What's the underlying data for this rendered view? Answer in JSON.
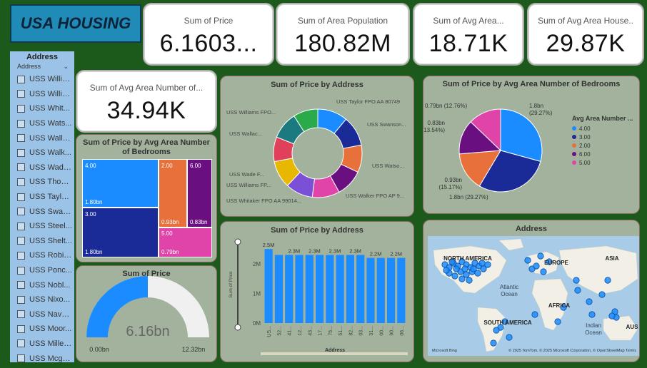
{
  "title": "USA HOUSING",
  "kpis": [
    {
      "label": "Sum of Price",
      "value": "6.1603..."
    },
    {
      "label": "Sum of Area Population",
      "value": "180.82M"
    },
    {
      "label": "Sum of Avg Area...",
      "value": "18.71K"
    },
    {
      "label": "Sum of Avg Area House..",
      "value": "29.87K"
    },
    {
      "label": "Sum of Avg Area Number of...",
      "value": "34.94K"
    }
  ],
  "slicer": {
    "header": "Address",
    "field": "Address",
    "items": [
      "USS Willia...",
      "USS Willia...",
      "USS Whit...",
      "USS Wats...",
      "USS Walla...",
      "USS Walk...",
      "USS Wade...",
      "USS Thom...",
      "USS Taylo...",
      "USS Swan...",
      "USS Steel...",
      "USS Shelt...",
      "USS Robin...",
      "USS Ponc...",
      "USS Nobl...",
      "USS Nixo...",
      "USS Nava...",
      "USS Moor...",
      "USS Miller...",
      "USS Mcge..."
    ]
  },
  "treemap": {
    "title": "Sum of Price by Avg Area Number of Bedrooms",
    "cells": [
      {
        "label": "4.00",
        "value": "1.80bn",
        "color": "#1a8cff"
      },
      {
        "label": "2.00",
        "value": "0.93bn",
        "color": "#e8703a"
      },
      {
        "label": "6.00",
        "value": "0.83bn",
        "color": "#6a0f80"
      },
      {
        "label": "3.00",
        "value": "1.80bn",
        "color": "#1a2a96"
      },
      {
        "label": "5.00",
        "value": "0.79bn",
        "color": "#e044a8"
      }
    ]
  },
  "gauge": {
    "title": "Sum of Price",
    "value": "6.16bn",
    "min": "0.00bn",
    "max": "12.32bn",
    "fraction": 0.5
  },
  "donut_title": "Sum of Price by Address",
  "pie": {
    "title": "Sum of Price by Avg Area Number of Bedrooms",
    "legend_title": "Avg Area Number ...",
    "legend": [
      "4.00",
      "3.00",
      "2.00",
      "6.00",
      "5.00"
    ],
    "labels": [
      "1.8bn",
      "(29.27%)",
      "1.8bn (29.27%)",
      "0.93bn",
      "(15.17%)",
      "0.83bn",
      "(13.54%)",
      "0.79bn (12.76%)"
    ]
  },
  "bar_title": "Sum of Price by Address",
  "map": {
    "title": "Address",
    "labels": [
      "NORTH AMERICA",
      "EUROPE",
      "ASIA",
      "Atlantic",
      "Ocean",
      "AFRICA",
      "SOUTH AMERICA",
      "Indian",
      "Ocean",
      "AUS"
    ],
    "bing": "Microsoft Bing",
    "copyright": "© 2025 TomTom, © 2025 Microsoft Corporation, © OpenStreetMap  Terms"
  },
  "chart_data": [
    {
      "type": "pie",
      "title": "Sum of Price by Address",
      "categories": [
        "USS Taylor FPO AA 80749",
        "USS Swanson...",
        "USS Watso...",
        "USS Walker FPO AP 9...",
        "USS Whitaker FPO AA 99014...",
        "USS Williams FP...",
        "USS Wade F...",
        "USS Wallac...",
        "USS Williams FPO...",
        ""
      ],
      "values": [
        11,
        11,
        10,
        10,
        10,
        10,
        10,
        9,
        10,
        9
      ],
      "colors": [
        "#1a8cff",
        "#1a2a96",
        "#e8703a",
        "#6a0f80",
        "#e044a8",
        "#7b4fd6",
        "#e8b800",
        "#e0405a",
        "#1a7a80",
        "#2aaa4a"
      ]
    },
    {
      "type": "pie",
      "title": "Sum of Price by Avg Area Number of Bedrooms",
      "categories": [
        "4.00",
        "3.00",
        "2.00",
        "6.00",
        "5.00"
      ],
      "values": [
        1.8,
        1.8,
        0.93,
        0.83,
        0.79
      ],
      "percent": [
        29.27,
        29.27,
        15.17,
        13.54,
        12.76
      ],
      "colors": [
        "#1a8cff",
        "#1a2a96",
        "#e8703a",
        "#6a0f80",
        "#e044a8"
      ]
    },
    {
      "type": "bar",
      "title": "Sum of Price by Address",
      "xlabel": "Address",
      "ylabel": "Sum of Price",
      "categories": [
        "US...",
        "52...",
        "41...",
        "12...",
        "43...",
        "17...",
        "75...",
        "51...",
        "82...",
        "03...",
        "31...",
        "00...",
        "90...",
        "06..."
      ],
      "values": [
        2.5,
        2.3,
        2.3,
        2.3,
        2.3,
        2.3,
        2.3,
        2.3,
        2.3,
        2.3,
        2.2,
        2.2,
        2.2,
        2.2
      ],
      "data_labels": [
        "2.5M",
        "",
        "2.3M",
        "",
        "2.3M",
        "",
        "2.3M",
        "",
        "2.3M",
        "",
        "2.2M",
        "",
        "2.2M",
        ""
      ],
      "yticks": [
        "0M",
        "1M",
        "2M"
      ],
      "ylim": [
        0,
        2.6
      ],
      "color": "#1a8cff"
    }
  ]
}
